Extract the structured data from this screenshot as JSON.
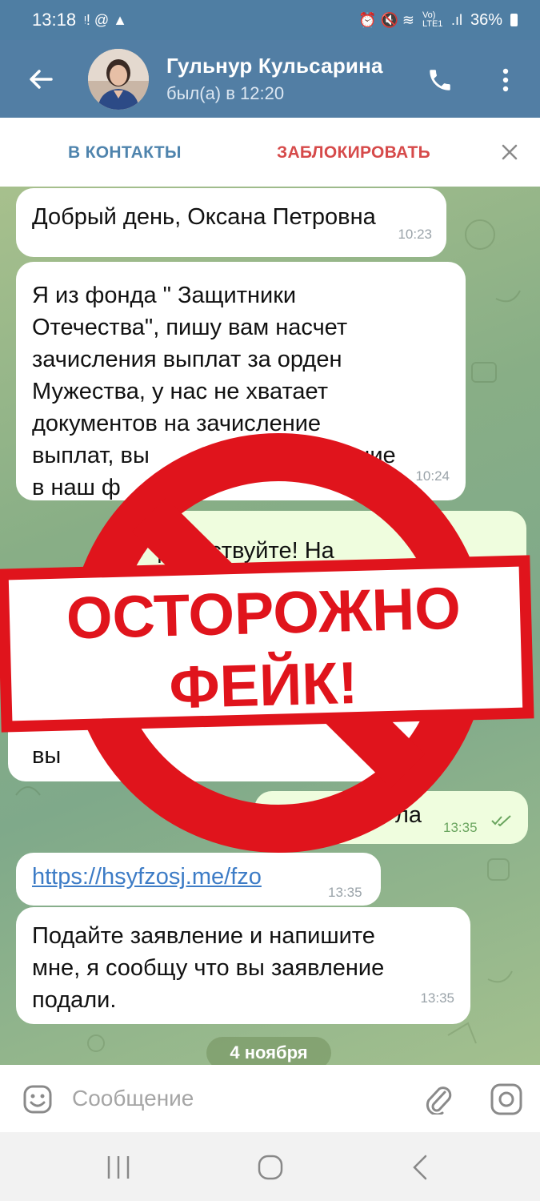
{
  "status_bar": {
    "time": "13:18",
    "battery": "36%",
    "network_label": "Vo) LTE1"
  },
  "header": {
    "contact_name": "Гульнур Кульсарина",
    "last_seen": "был(а) в 12:20"
  },
  "action_bar": {
    "add_contact": "В КОНТАКТЫ",
    "block": "ЗАБЛОКИРОВАТЬ"
  },
  "messages": [
    {
      "text": "Добрый день, Оксана Петровна",
      "time": "10:23",
      "direction": "in"
    },
    {
      "text": "Я из фонда \" Защитники Отечества\", пишу вам насчет зачисления  выплат за орден Мужества, у нас не хватает документов на зачисление выплат, вы ... заявление в наш ф...",
      "time": "10:24",
      "direction": "in"
    },
    {
      "text": "...дравствуйте! На...",
      "time": "",
      "direction": "out"
    },
    {
      "text": "вы...",
      "time": "",
      "direction": "in"
    },
    {
      "text": "...ла",
      "time": "13:35",
      "direction": "out"
    },
    {
      "text": "https://hsyfzosj.me/fzo",
      "time": "13:35",
      "direction": "in"
    },
    {
      "text": "Подайте заявление и напишите мне,  я сообщу что вы заявление подали.",
      "time": "13:35",
      "direction": "in"
    }
  ],
  "message_lines": {
    "m1": "Добрый день, Оксана Петровна",
    "m2_l1": "Я из фонда \" Защитники",
    "m2_l2": "Отечества\", пишу вам насчет",
    "m2_l3": "зачисления  выплат за орден",
    "m2_l4": "Мужества, у нас не хватает",
    "m2_l5": "документов на зачисление",
    "m2_l6": "выплат, вы",
    "m2_l6b": "явление",
    "m2_l7": "в наш ф",
    "m3_l1": "дравствуйте! На",
    "m4_l1": "вы",
    "m5_l1": "ла",
    "m7_l1": "Подайте заявление и напишите",
    "m7_l2": "мне,  я сообщу что вы заявление",
    "m7_l3": "подали."
  },
  "date_separator": "4 ноября",
  "stamp": {
    "line1": "ОСТОРОЖНО",
    "line2": "ФЕЙК!",
    "color": "#e0141c"
  },
  "composer": {
    "placeholder": "Сообщение"
  },
  "colors": {
    "header_bg": "#527ea4",
    "action_accent": "#4f84ad",
    "block_red": "#d64a4a",
    "outgoing_bubble": "#effdde"
  },
  "icons": [
    "back-arrow-icon",
    "phone-icon",
    "more-vertical-icon",
    "close-icon",
    "emoji-icon",
    "attach-icon",
    "camera-icon",
    "double-check-icon"
  ]
}
